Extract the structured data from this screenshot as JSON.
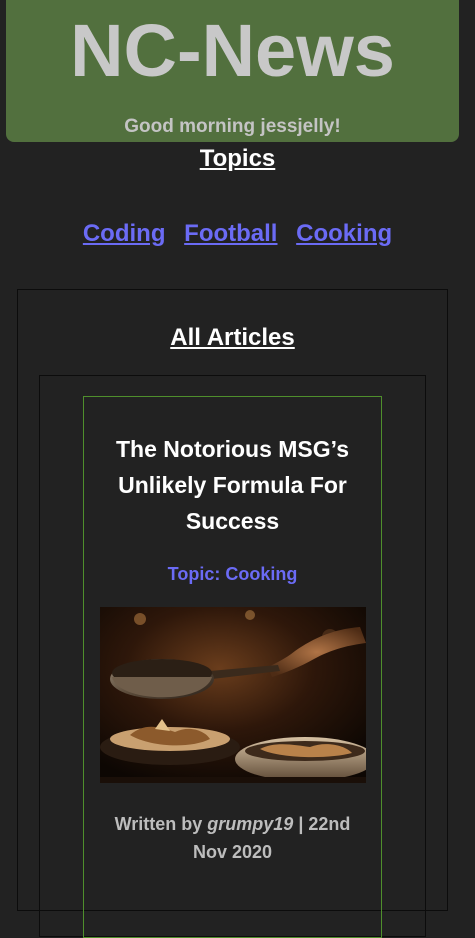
{
  "header": {
    "title": "NC-News",
    "greeting": "Good morning jessjelly!"
  },
  "topics": {
    "heading": "Topics",
    "links": [
      "Coding",
      "Football",
      "Cooking"
    ]
  },
  "articles": {
    "heading": "All Articles",
    "items": [
      {
        "title": "The Notorious MSG’s Unlikely Formula For Success",
        "topic_label": "Topic: Cooking",
        "image_icon": "cooking-pan-photo",
        "written_by": "Written by",
        "author": "grumpy19",
        "separator": "|",
        "date": "22nd Nov 2020"
      }
    ]
  },
  "colors": {
    "header_bg": "#52703e",
    "page_bg": "#222222",
    "link": "#6b6bf5",
    "card_border": "#4f8f2c"
  }
}
